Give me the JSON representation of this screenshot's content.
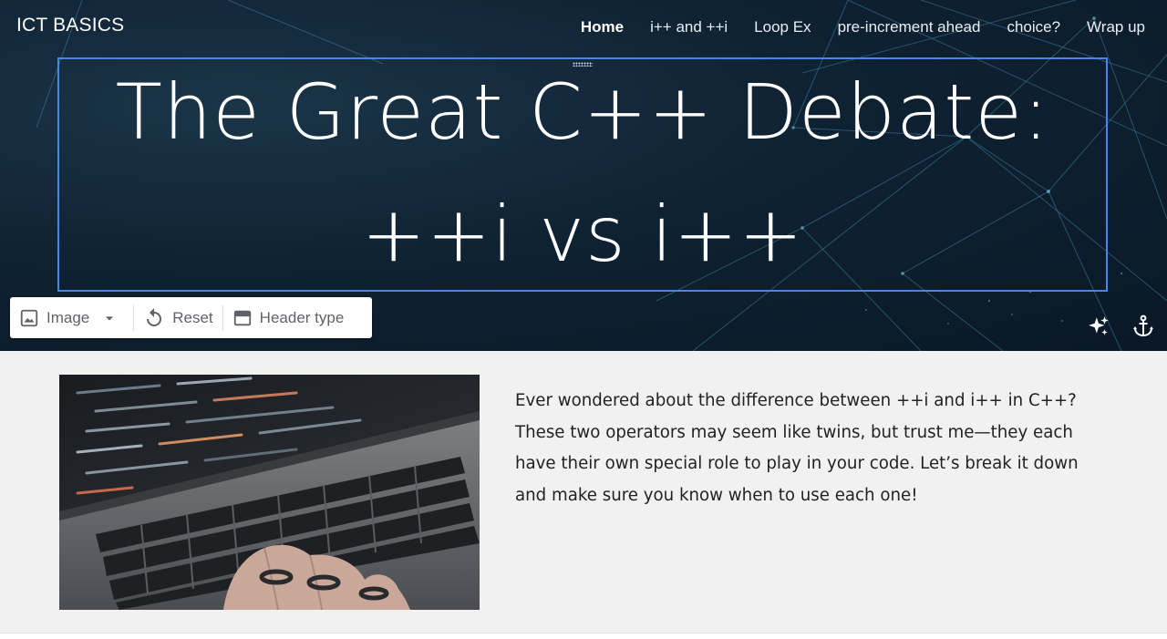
{
  "header": {
    "brand": "ICT BASICS",
    "nav": [
      {
        "label": "Home",
        "active": true
      },
      {
        "label": "i++ and ++i",
        "active": false
      },
      {
        "label": "Loop Ex",
        "active": false
      },
      {
        "label": "pre-increment ahead",
        "active": false
      },
      {
        "label": "choice?",
        "active": false
      },
      {
        "label": "Wrap up",
        "active": false
      }
    ],
    "title_line1": "The Great C++ Debate:",
    "title_line2": "++i vs i++",
    "accent_color": "#4a86e8"
  },
  "toolbar": {
    "image_label": "Image",
    "reset_label": "Reset",
    "header_type_label": "Header type"
  },
  "hero_icons": [
    "sparkle-icon",
    "anchor-icon"
  ],
  "content": {
    "image_alt_icon": "laptop-keyboard-photo",
    "intro_text": "Ever wondered about the difference between ++i and i++ in C++? These two operators may seem like twins, but trust me—they each have their own special role to play in your code. Let’s break it down and make sure you know when to use each one!"
  }
}
